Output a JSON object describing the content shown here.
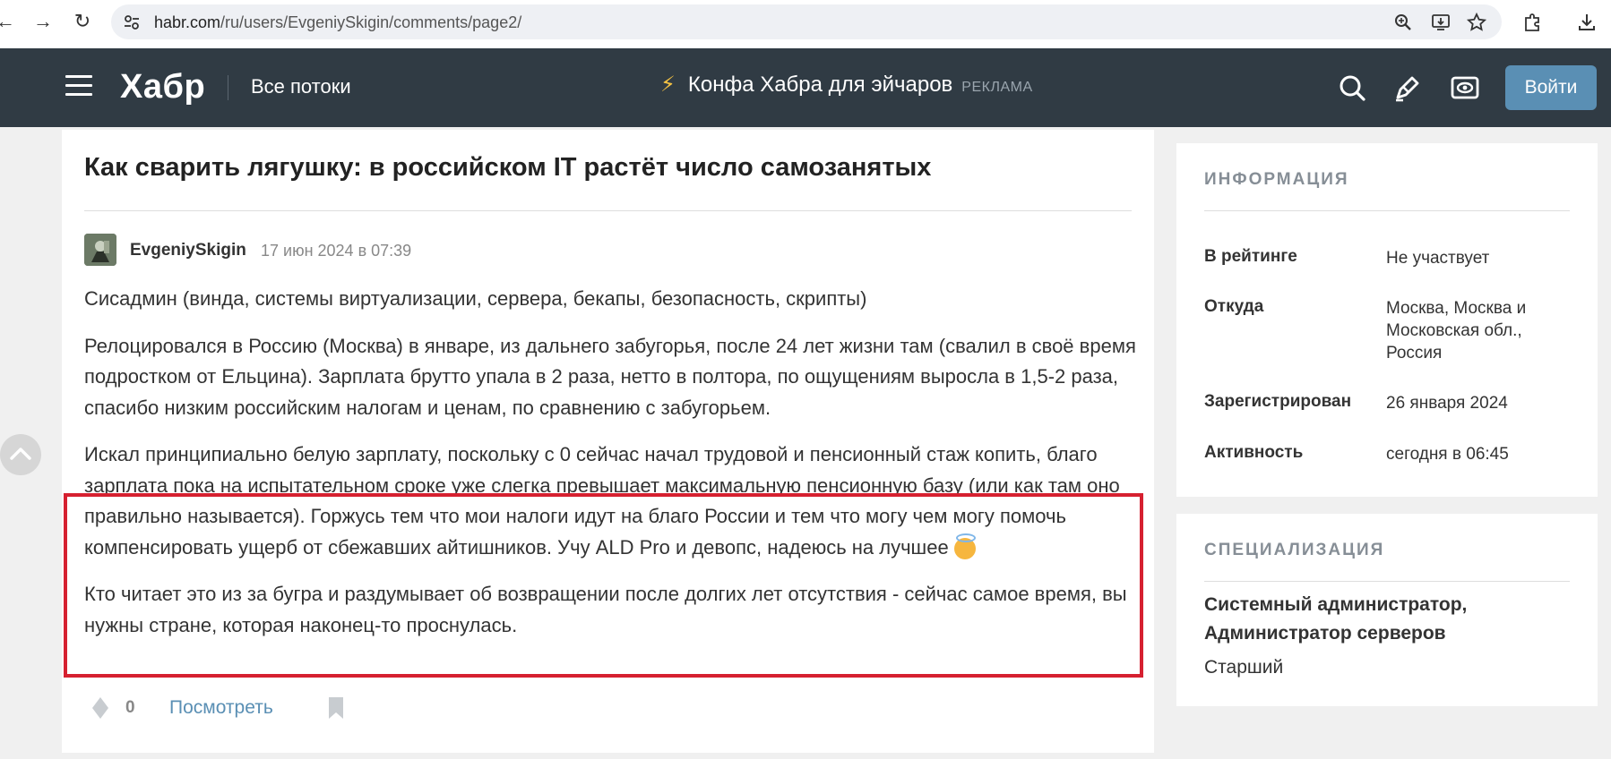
{
  "browser": {
    "url_domain": "habr.com",
    "url_path": "/ru/users/EvgeniySkigin/comments/page2/"
  },
  "header": {
    "logo": "Хабр",
    "streams": "Все потоки",
    "promo_text": "Конфа Хабра для эйчаров",
    "promo_ad": "РЕКЛАМА",
    "login": "Войти"
  },
  "comment": {
    "article_title": "Как сварить лягушку: в российском IT растёт число самозанятых",
    "author": "EvgeniySkigin",
    "date": "17 июн 2024 в 07:39",
    "paragraphs": [
      "Сисадмин (винда, системы виртуализации, сервера, бекапы, безопасность, скрипты)",
      "Релоцировался в Россию (Москва) в январе, из дальнего забугорья, после 24 лет жизни там (свалил в своё время подростком от Ельцина). Зарплата брутто упала в 2 раза, нетто в полтора, по ощущениям выросла в 1,5-2 раза, спасибо низким российским налогам и ценам, по сравнению с забугорьем.",
      "Искал принципиально белую зарплату, поскольку с 0 сейчас начал трудовой и пенсионный стаж копить, благо зарплата пока на испытательном сроке уже слегка превышает максимальную пенсионную базу (или как там оно правильно называется). Горжусь тем что мои налоги идут на благо России и тем что могу чем могу помочь компенсировать ущерб от сбежавших айтишников. Учу ALD Pro и девопс, надеюсь на лучшее",
      "Кто читает это из за бугра и раздумывает об возвращении после долгих лет отсутствия - сейчас самое время, вы нужны стране, которая наконец-то проснулась."
    ],
    "rating": "0",
    "view_link": "Посмотреть"
  },
  "sidebar": {
    "info_heading": "ИНФОРМАЦИЯ",
    "info_rows": [
      {
        "label": "В рейтинге",
        "value": "Не участвует"
      },
      {
        "label": "Откуда",
        "value": "Москва, Москва и Московская обл., Россия"
      },
      {
        "label": "Зарегистрирован",
        "value": "26 января 2024"
      },
      {
        "label": "Активность",
        "value": "сегодня в 06:45"
      }
    ],
    "spec_heading": "СПЕЦИАЛИЗАЦИЯ",
    "spec_title": "Системный администратор, Администратор серверов",
    "spec_level": "Старший"
  },
  "colors": {
    "header_bg": "#303b44",
    "accent_blue": "#5a8fb4",
    "highlight_red": "#d62030"
  }
}
